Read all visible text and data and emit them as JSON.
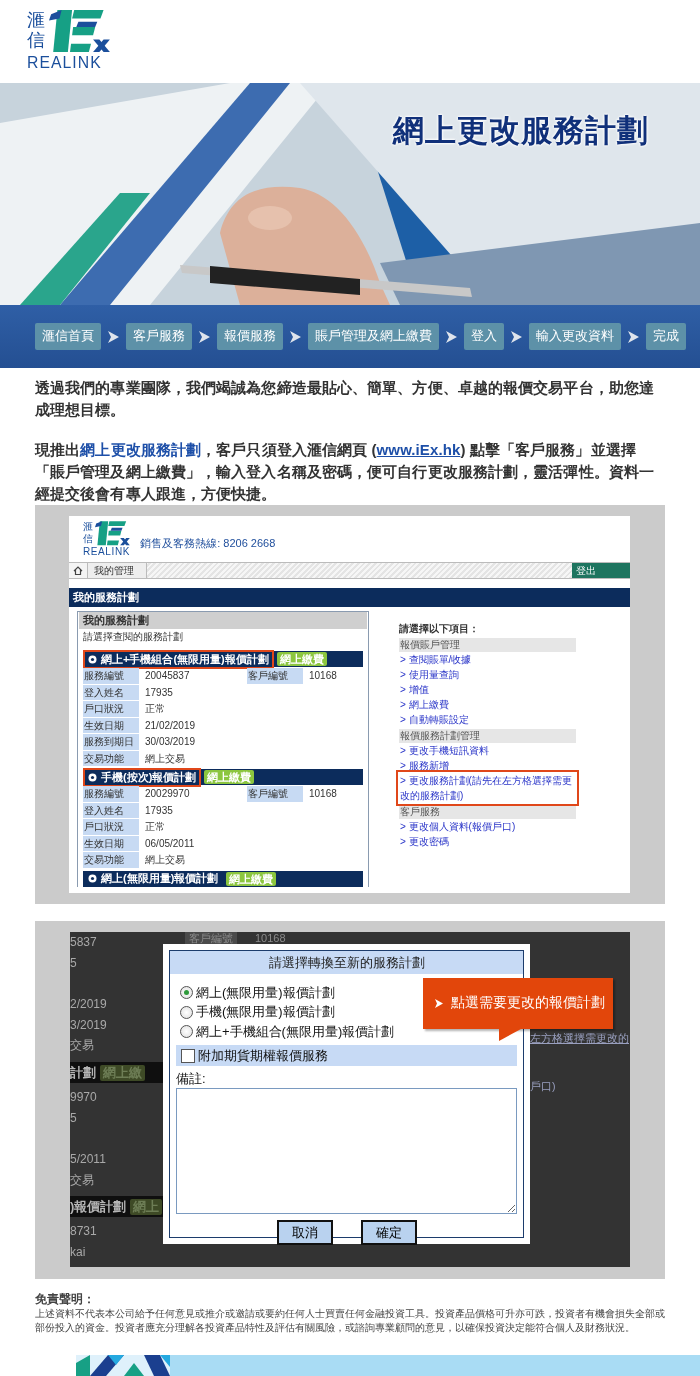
{
  "header": {
    "logo": {
      "chars": [
        "滙",
        "信"
      ],
      "wordmark": "REALINK"
    }
  },
  "hero": {
    "kind": "picture",
    "title": "網上更改服務計劃"
  },
  "breadcrumb": [
    {
      "label": "滙信首頁"
    },
    {
      "label": "客戶服務"
    },
    {
      "label": "報價服務"
    },
    {
      "label": "賬戶管理及網上繳費"
    },
    {
      "label": "登入"
    },
    {
      "label": "輸入更改資料"
    },
    {
      "label": "完成"
    }
  ],
  "article": {
    "intro": "透過我們的專業團隊，我們竭誠為您締造最貼心、簡單、方便、卓越的報價交易平台，助您達成理想目標。",
    "body": [
      {
        "kind": "text",
        "text": "現推出"
      },
      {
        "kind": "link",
        "text": "網上更改服務計劃",
        "underlined": false
      },
      {
        "kind": "text",
        "text": "，客戶只須登入滙信網頁 ("
      },
      {
        "kind": "link",
        "text": "www.iEx.hk",
        "underlined": true
      },
      {
        "kind": "text",
        "text": ") 點擊「客戶服務」並選擇「賬戶管理及網上繳費」，輸入登入名稱及密碼，便可自行更改服務計劃，靈活彈性。資料一經提交後會有專人跟進，方便快捷。"
      }
    ]
  },
  "screenshot_1": {
    "logo": {
      "chars": [
        "滙",
        "信"
      ],
      "wordmark": "REALINK"
    },
    "hotline": "銷售及客務熱線: 8206 2668",
    "nav": {
      "tab": "我的管理",
      "logout": "登出"
    },
    "title": "我的服務計劃",
    "plans_panel": {
      "title": "我的服務計劃",
      "subtitle": "請選擇查閱的服務計劃",
      "plans": [
        {
          "name": "網上+手機組合(無限用量)報價計劃",
          "badge": "網上繳費",
          "highlighted": true,
          "rows": [
            {
              "label": "服務編號",
              "value": "20045837",
              "label_2": "客戶編號",
              "value_2": "10168"
            },
            {
              "label": "登入姓名",
              "value": "17935"
            },
            {
              "label": "戶口狀況",
              "value": "正常"
            },
            {
              "label": "生效日期",
              "value": "21/02/2019"
            },
            {
              "label": "服務到期日",
              "value": "30/03/2019"
            },
            {
              "label": "交易功能",
              "value": "網上交易"
            }
          ]
        },
        {
          "name": "手機(按次)報價計劃",
          "badge": "網上繳費",
          "highlighted": true,
          "rows": [
            {
              "label": "服務編號",
              "value": "20029970",
              "label_2": "客戶編號",
              "value_2": "10168"
            },
            {
              "label": "登入姓名",
              "value": "17935"
            },
            {
              "label": "戶口狀況",
              "value": "正常"
            },
            {
              "label": "生效日期",
              "value": "06/05/2011"
            },
            {
              "label": "交易功能",
              "value": "網上交易"
            }
          ]
        },
        {
          "name": "網上(無限用量)報價計劃",
          "badge": "網上繳費",
          "highlighted": false
        }
      ]
    },
    "menu": {
      "title": "請選擇以下項目：",
      "sections": [
        {
          "heading": "報價賬戶管理",
          "links": [
            {
              "text": "> 查閱賬單/收據",
              "highlighted": false
            },
            {
              "text": "> 使用量查詢",
              "highlighted": false
            },
            {
              "text": "> 增值",
              "highlighted": false
            },
            {
              "text": "> 網上繳費",
              "highlighted": false
            },
            {
              "text": "> 自動轉賬設定",
              "highlighted": false
            }
          ]
        },
        {
          "heading": "報價服務計劃管理",
          "links": [
            {
              "text": "> 更改手機短訊資料",
              "highlighted": false
            },
            {
              "text": "> 服務新增",
              "highlighted": false
            },
            {
              "text": "> 更改服務計劃(請先在左方格選擇需更改的服務計劃)",
              "highlighted": true
            }
          ]
        },
        {
          "heading": "客戶服務",
          "links": [
            {
              "text": "> 更改個人資料(報價戶口)",
              "highlighted": false
            },
            {
              "text": "> 更改密碼",
              "highlighted": false
            }
          ]
        }
      ]
    }
  },
  "screenshot_2": {
    "backdrop_rows": [
      {
        "kind": "row",
        "text": "5837",
        "text_2": "客戶編號",
        "text_3": "10168"
      },
      {
        "kind": "row",
        "text": "5"
      },
      {
        "kind": "gap"
      },
      {
        "kind": "row",
        "text": "2/2019"
      },
      {
        "kind": "row",
        "text": "3/2019"
      },
      {
        "kind": "row",
        "text": "交易"
      },
      {
        "kind": "bar",
        "text": "計劃",
        "badge": "網上繳"
      },
      {
        "kind": "row",
        "text": "9970"
      },
      {
        "kind": "row",
        "text": "5"
      },
      {
        "kind": "gap"
      },
      {
        "kind": "row",
        "text": "5/2011"
      },
      {
        "kind": "row",
        "text": "交易"
      },
      {
        "kind": "bar",
        "text": ")報價計劃",
        "badge": "網上"
      },
      {
        "kind": "row",
        "text": "8731"
      },
      {
        "kind": "row",
        "text": "kai"
      }
    ],
    "backdrop_links": [
      {
        "text": "左方格選擇需更改的"
      },
      {
        "text": "戶口)"
      }
    ],
    "modal": {
      "title": "請選擇轉換至新的服務計劃",
      "options": [
        {
          "label": "網上(無限用量)報價計劃",
          "selected": true
        },
        {
          "label": "手機(無限用量)報價計劃",
          "selected": false
        },
        {
          "label": "網上+手機組合(無限用量)報價計劃",
          "selected": false
        }
      ],
      "addon": {
        "label": "附加期貨期權報價服務",
        "checked": false
      },
      "remark_label": "備註:",
      "buttons": [
        "取消",
        "確定"
      ]
    },
    "callout": {
      "text": "點選需要更改的報價計劃"
    }
  },
  "disclaimer": {
    "title": "免責聲明：",
    "text": "上述資料不代表本公司給予任何意見或推介或邀請或要約任何人士買賣任何金融投資工具。投資產品價格可升亦可跌，投資者有機會損失全部或部份投入的資金。投資者應充分理解各投資產品特性及評估有關風險，或諮詢專業顧問的意見，以確保投資決定能符合個人及財務狀況。"
  }
}
